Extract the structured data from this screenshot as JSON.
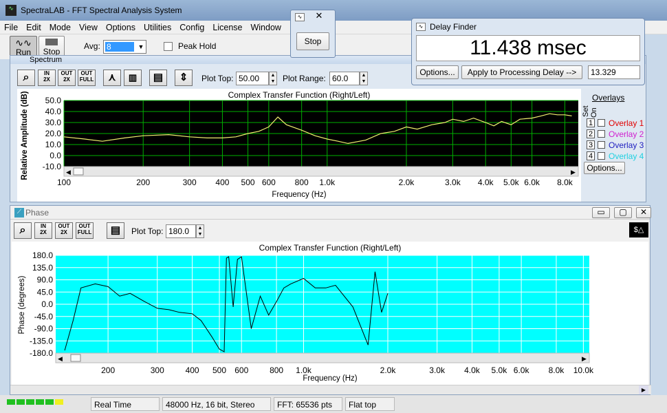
{
  "app": {
    "title": "SpectraLAB - FFT Spectral Analysis System"
  },
  "menu": [
    "File",
    "Edit",
    "Mode",
    "View",
    "Options",
    "Utilities",
    "Config",
    "License",
    "Window"
  ],
  "toolbar": {
    "run_label": "Run",
    "stop_label": "Stop",
    "avg_label": "Avg:",
    "avg_value": "8",
    "peak_hold_label": "Peak Hold"
  },
  "stop_dialog": {
    "button": "Stop"
  },
  "delay_finder": {
    "title": "Delay Finder",
    "value": "11.438 msec",
    "options_button": "Options...",
    "apply_button": "Apply to Processing Delay -->",
    "delay_field": "13.329"
  },
  "spectrum": {
    "window_title": "Spectrum",
    "toolbar_icons": [
      "zoom-icon",
      "zoom-in-2x-icon",
      "zoom-out-2x-icon",
      "zoom-out-full-icon",
      "peak-marker-icon",
      "bars-icon",
      "table-icon",
      "autoscale-icon"
    ],
    "zoom_labels": [
      [
        "IN",
        "2X"
      ],
      [
        "OUT",
        "2X"
      ],
      [
        "OUT",
        "FULL"
      ]
    ],
    "plot_top_label": "Plot Top:",
    "plot_top_value": "50.00",
    "plot_range_label": "Plot Range:",
    "plot_range_value": "60.0",
    "chart_title": "Complex Transfer Function (Right/Left)",
    "ylabel": "Relative Amplitude (dB)",
    "xlabel": "Frequency (Hz)",
    "yticks": [
      "50.0",
      "40.0",
      "30.0",
      "20.0",
      "10.0",
      "0.0",
      "-10.0"
    ],
    "xticks": [
      "100",
      "200",
      "300",
      "400",
      "500",
      "600",
      "800",
      "1.0k",
      "2.0k",
      "3.0k",
      "4.0k",
      "5.0k",
      "6.0k",
      "8.0k"
    ],
    "overlays": {
      "title": "Overlays",
      "set_label": "Set",
      "on_label": "On",
      "items": [
        {
          "num": "1",
          "label": "Overlay 1",
          "color": "#e00000"
        },
        {
          "num": "2",
          "label": "Overlay 2",
          "color": "#d020d0"
        },
        {
          "num": "3",
          "label": "Overlay 3",
          "color": "#2020c0"
        },
        {
          "num": "4",
          "label": "Overlay 4",
          "color": "#20d0e0"
        }
      ],
      "options_button": "Options..."
    },
    "trace_color": "#f0f070",
    "bg_color": "#000000",
    "grid_color": "#00b000"
  },
  "phase": {
    "window_title": "Phase",
    "zoom_labels": [
      [
        "IN",
        "2X"
      ],
      [
        "OUT",
        "2X"
      ],
      [
        "OUT",
        "FULL"
      ]
    ],
    "plot_top_label": "Plot Top:",
    "plot_top_value": "180.0",
    "chart_title": "Complex Transfer Function (Right/Left)",
    "ylabel": "Phase (degrees)",
    "xlabel": "Frequency (Hz)",
    "yticks": [
      "180.0",
      "135.0",
      "90.0",
      "45.0",
      "0.0",
      "-45.0",
      "-90.0",
      "-135.0",
      "-180.0"
    ],
    "xticks": [
      "200",
      "300",
      "400",
      "500",
      "600",
      "800",
      "1.0k",
      "2.0k",
      "3.0k",
      "4.0k",
      "5.0k",
      "6.0k",
      "8.0k",
      "10.0k"
    ],
    "bg_color": "#00ffff"
  },
  "statusbar": {
    "mode": "Real Time",
    "format": "48000 Hz, 16 bit, Stereo",
    "fft": "FFT: 65536 pts",
    "window": "Flat top"
  },
  "chart_data": [
    {
      "type": "line",
      "title": "Complex Transfer Function (Right/Left)",
      "xlabel": "Frequency (Hz)",
      "ylabel": "Relative Amplitude (dB)",
      "xscale": "log",
      "ylim": [
        -10,
        50
      ],
      "x": [
        100,
        120,
        140,
        170,
        200,
        250,
        300,
        350,
        400,
        450,
        500,
        550,
        600,
        650,
        700,
        800,
        900,
        1000,
        1100,
        1200,
        1400,
        1600,
        1800,
        2000,
        2200,
        2500,
        2800,
        3000,
        3300,
        3600,
        4000,
        4300,
        4600,
        5000,
        5400,
        6000,
        6500,
        7000,
        7500,
        8000,
        8500
      ],
      "series": [
        {
          "values": [
            17,
            15,
            13,
            16,
            18,
            19,
            17,
            16,
            16,
            17,
            20,
            22,
            26,
            35,
            28,
            23,
            18,
            15,
            13,
            11,
            14,
            20,
            22,
            26,
            24,
            28,
            30,
            33,
            31,
            34,
            30,
            27,
            31,
            28,
            33,
            34,
            36,
            38,
            37,
            37,
            36
          ]
        }
      ]
    },
    {
      "type": "line",
      "title": "Complex Transfer Function (Right/Left)",
      "xlabel": "Frequency (Hz)",
      "ylabel": "Phase (degrees)",
      "xscale": "log",
      "ylim": [
        -180,
        180
      ],
      "x": [
        140,
        150,
        160,
        180,
        200,
        220,
        240,
        270,
        300,
        330,
        360,
        400,
        430,
        470,
        500,
        520,
        530,
        540,
        560,
        580,
        600,
        650,
        700,
        750,
        800,
        850,
        900,
        1000,
        1100,
        1200,
        1300,
        1500,
        1700,
        1800,
        1900,
        2000
      ],
      "series": [
        {
          "values": [
            -170,
            -60,
            60,
            75,
            65,
            30,
            40,
            10,
            -15,
            -20,
            -30,
            -35,
            -60,
            -120,
            -165,
            -175,
            170,
            175,
            -10,
            165,
            175,
            -90,
            30,
            -40,
            10,
            60,
            75,
            95,
            60,
            60,
            70,
            -10,
            -150,
            120,
            -30,
            40
          ]
        }
      ]
    }
  ]
}
